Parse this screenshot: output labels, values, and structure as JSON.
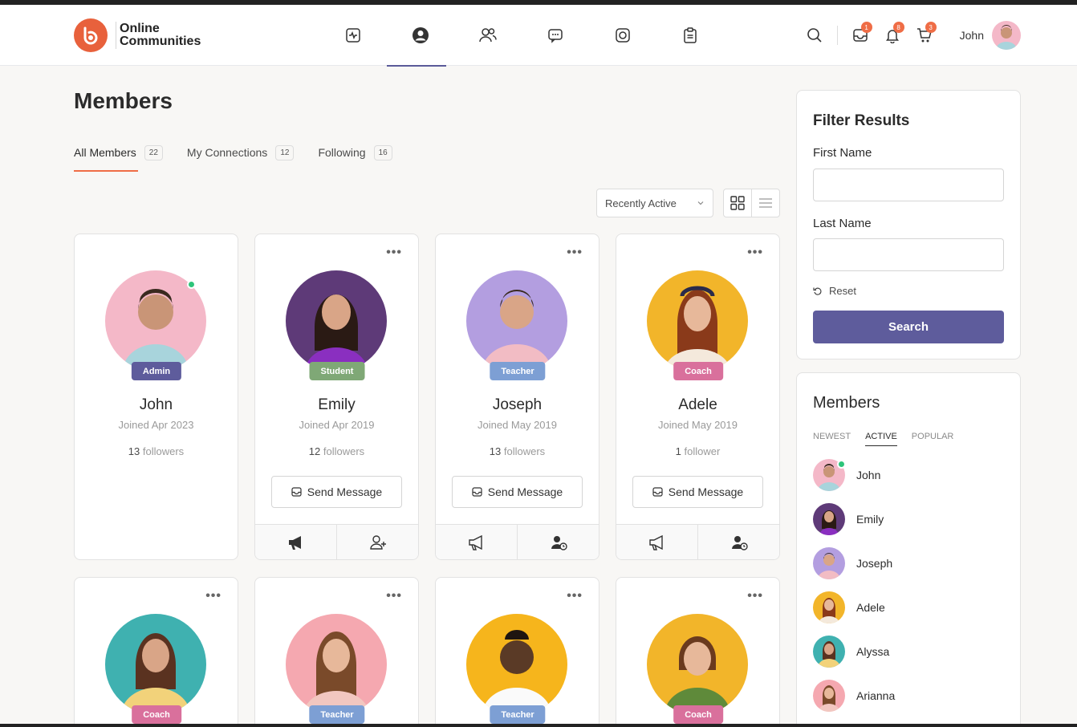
{
  "header": {
    "logo_line1": "Online",
    "logo_line2": "Communities",
    "user_name": "John",
    "messages_count": "1",
    "notifications_count": "8",
    "cart_count": "3",
    "nav_icons": [
      "activity-icon",
      "profile-icon",
      "members-icon",
      "forums-icon",
      "photos-icon",
      "documents-icon"
    ]
  },
  "page": {
    "title": "Members",
    "tabs": [
      {
        "label": "All Members",
        "count": "22"
      },
      {
        "label": "My Connections",
        "count": "12"
      },
      {
        "label": "Following",
        "count": "16"
      }
    ],
    "sort_value": "Recently Active"
  },
  "members": [
    {
      "name": "John",
      "joined": "Joined Apr 2023",
      "followers_num": "13",
      "followers_word": "followers",
      "role": "Admin",
      "role_color": "#5e5c9c",
      "bg": "#f4b8c8"
    },
    {
      "name": "Emily",
      "joined": "Joined Apr 2019",
      "followers_num": "12",
      "followers_word": "followers",
      "role": "Student",
      "role_color": "#7fa876",
      "bg": "#5e3a78",
      "send": "Send Message"
    },
    {
      "name": "Joseph",
      "joined": "Joined May 2019",
      "followers_num": "13",
      "followers_word": "followers",
      "role": "Teacher",
      "role_color": "#7d9fd4",
      "bg": "#b39ee0",
      "send": "Send Message"
    },
    {
      "name": "Adele",
      "joined": "Joined May 2019",
      "followers_num": "1",
      "followers_word": "follower",
      "role": "Coach",
      "role_color": "#d9709c",
      "bg": "#f2b52a",
      "send": "Send Message"
    },
    {
      "role": "Coach",
      "role_color": "#d9709c",
      "bg": "#3fb1b0"
    },
    {
      "role": "Teacher",
      "role_color": "#7d9fd4",
      "bg": "#f5a8b0"
    },
    {
      "role": "Teacher",
      "role_color": "#7d9fd4",
      "bg": "#f6b51c"
    },
    {
      "role": "Coach",
      "role_color": "#d9709c",
      "bg": "#f2b52a"
    }
  ],
  "filter": {
    "title": "Filter Results",
    "first_name_label": "First Name",
    "last_name_label": "Last Name",
    "reset_label": "Reset",
    "search_label": "Search"
  },
  "members_widget": {
    "title": "Members",
    "tabs": [
      "NEWEST",
      "ACTIVE",
      "POPULAR"
    ],
    "list": [
      "John",
      "Emily",
      "Joseph",
      "Adele",
      "Alyssa",
      "Arianna"
    ]
  }
}
